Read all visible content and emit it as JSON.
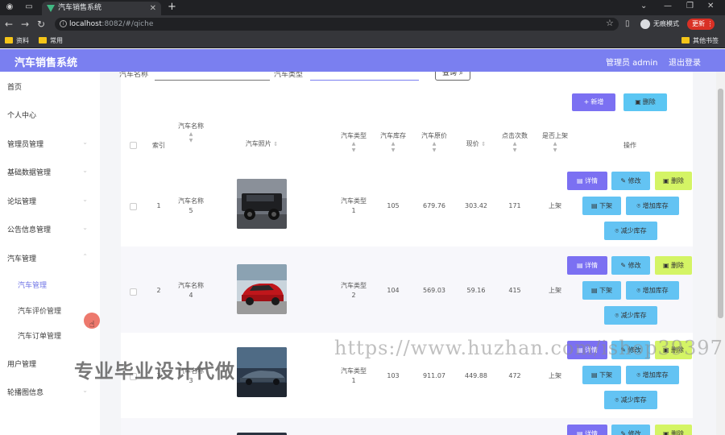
{
  "browser": {
    "tab_title": "汽车销售系统",
    "url_host": "localhost",
    "url_path": ":8082/#/qiche",
    "profile_label": "无痕模式",
    "update_label": "更新",
    "bookmarks": [
      "资料",
      "常用"
    ],
    "other_bookmarks": "其他书签"
  },
  "header": {
    "title": "汽车销售系统",
    "admin_label": "管理员 admin",
    "logout_label": "退出登录"
  },
  "sidebar": {
    "items": [
      {
        "label": "首页"
      },
      {
        "label": "个人中心"
      },
      {
        "label": "管理员管理"
      },
      {
        "label": "基础数据管理"
      },
      {
        "label": "论坛管理"
      },
      {
        "label": "公告信息管理"
      },
      {
        "label": "汽车管理"
      }
    ],
    "sub_items": [
      {
        "label": "汽车管理",
        "active": true
      },
      {
        "label": "汽车评价管理",
        "active": false
      },
      {
        "label": "汽车订单管理",
        "active": false
      }
    ],
    "items_after": [
      {
        "label": "用户管理"
      },
      {
        "label": "轮播图信息"
      }
    ]
  },
  "search": {
    "name_label": "汽车名称",
    "type_label": "汽车类型",
    "button_label": "查询"
  },
  "toolbar": {
    "add_label": "新增",
    "delete_label": "删除"
  },
  "table": {
    "headers": {
      "index": "索引",
      "name": "汽车名称",
      "photo": "汽车照片",
      "type": "汽车类型",
      "stock": "汽车库存",
      "original_price": "汽车原价",
      "current_price": "现价",
      "clicks": "点击次数",
      "listed": "是否上架",
      "ops": "操作"
    },
    "rows": [
      {
        "index": "1",
        "name": "汽车名称",
        "name_no": "5",
        "type": "汽车类型",
        "type_no": "1",
        "stock": "105",
        "original_price": "679.76",
        "current_price": "303.42",
        "clicks": "171",
        "listed": "上架"
      },
      {
        "index": "2",
        "name": "汽车名称",
        "name_no": "4",
        "type": "汽车类型",
        "type_no": "2",
        "stock": "104",
        "original_price": "569.03",
        "current_price": "59.16",
        "clicks": "415",
        "listed": "上架"
      },
      {
        "index": "3",
        "name": "汽车名称",
        "name_no": "3",
        "type": "汽车类型",
        "type_no": "1",
        "stock": "103",
        "original_price": "911.07",
        "current_price": "449.88",
        "clicks": "472",
        "listed": "上架"
      }
    ],
    "op_labels": {
      "detail": "详情",
      "edit": "修改",
      "delete": "删除",
      "off_shelf": "下架",
      "add_stock": "增加库存",
      "reduce_stock": "减少库存"
    }
  },
  "watermarks": {
    "left": "专业毕业设计代做",
    "right": "https://www.huzhan.com/ishop39397"
  },
  "colors": {
    "header": "#7a7ff0",
    "primary": "#7b70f2",
    "info": "#63c3f3",
    "warn": "#d4f465",
    "active_menu": "#6f74e6"
  }
}
